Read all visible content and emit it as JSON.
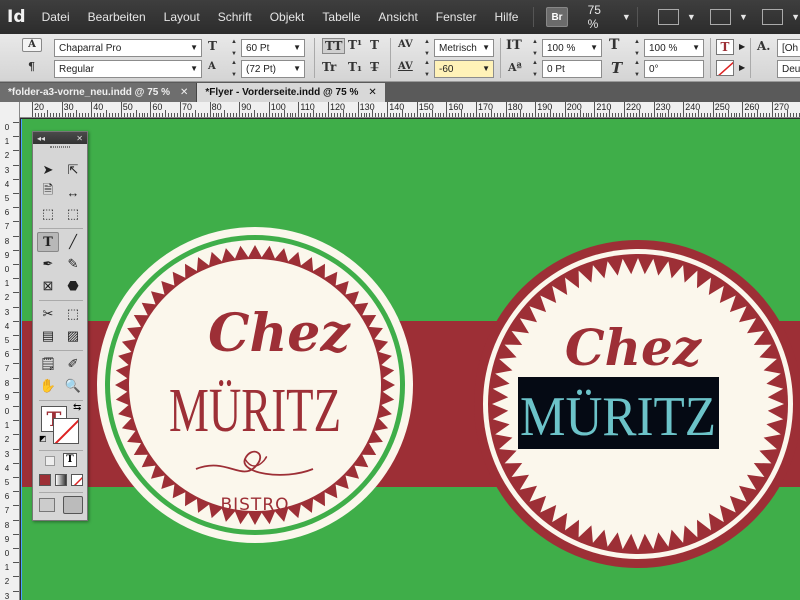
{
  "app": {
    "logo": "Id"
  },
  "menu": {
    "items": [
      "Datei",
      "Bearbeiten",
      "Layout",
      "Schrift",
      "Objekt",
      "Tabelle",
      "Ansicht",
      "Fenster",
      "Hilfe"
    ],
    "bridge_label": "Br",
    "zoom": "75 %"
  },
  "control": {
    "font_family": "Chaparral Pro",
    "font_style": "Regular",
    "font_size": "60 Pt",
    "leading": "(72 Pt)",
    "kerning": "Metrisch",
    "tracking": "-60",
    "vertical_scale": "100 %",
    "horizontal_scale": "100 %",
    "baseline_shift": "0 Pt",
    "skew": "0°",
    "char_style": "[Oh",
    "language": "Deu"
  },
  "tabs": [
    {
      "label": "*folder-a3-vorne_neu.indd @ 75 %",
      "active": false
    },
    {
      "label": "*Flyer - Vorderseite.indd @ 75 %",
      "active": true
    }
  ],
  "ruler": {
    "h_labels": [
      "20",
      "30",
      "40",
      "50",
      "60",
      "70",
      "80",
      "90",
      "100",
      "110",
      "120",
      "130",
      "140",
      "150",
      "160",
      "170",
      "180",
      "190",
      "200",
      "210",
      "220",
      "230",
      "240",
      "250",
      "260",
      "270"
    ],
    "v_labels": [
      "0",
      "1",
      "2",
      "3",
      "4",
      "5",
      "6",
      "7",
      "8",
      "9",
      "10",
      "11",
      "12",
      "13",
      "14",
      "15",
      "16",
      "17",
      "18",
      "19",
      "20",
      "21",
      "22",
      "23",
      "24",
      "25",
      "26",
      "27",
      "28",
      "29",
      "30",
      "31",
      "32",
      "33",
      "34"
    ]
  },
  "artwork": {
    "left_badge": {
      "top": "Chez",
      "name": "MÜRITZ",
      "sub": "BISTRO"
    },
    "right_badge": {
      "top": "Chez",
      "name": "MÜRITZ"
    },
    "colors": {
      "green": "#3fae49",
      "red": "#9d2f36",
      "cream": "#fbf7ec",
      "teal": "#6cc3c9",
      "black": "#050a14"
    }
  }
}
